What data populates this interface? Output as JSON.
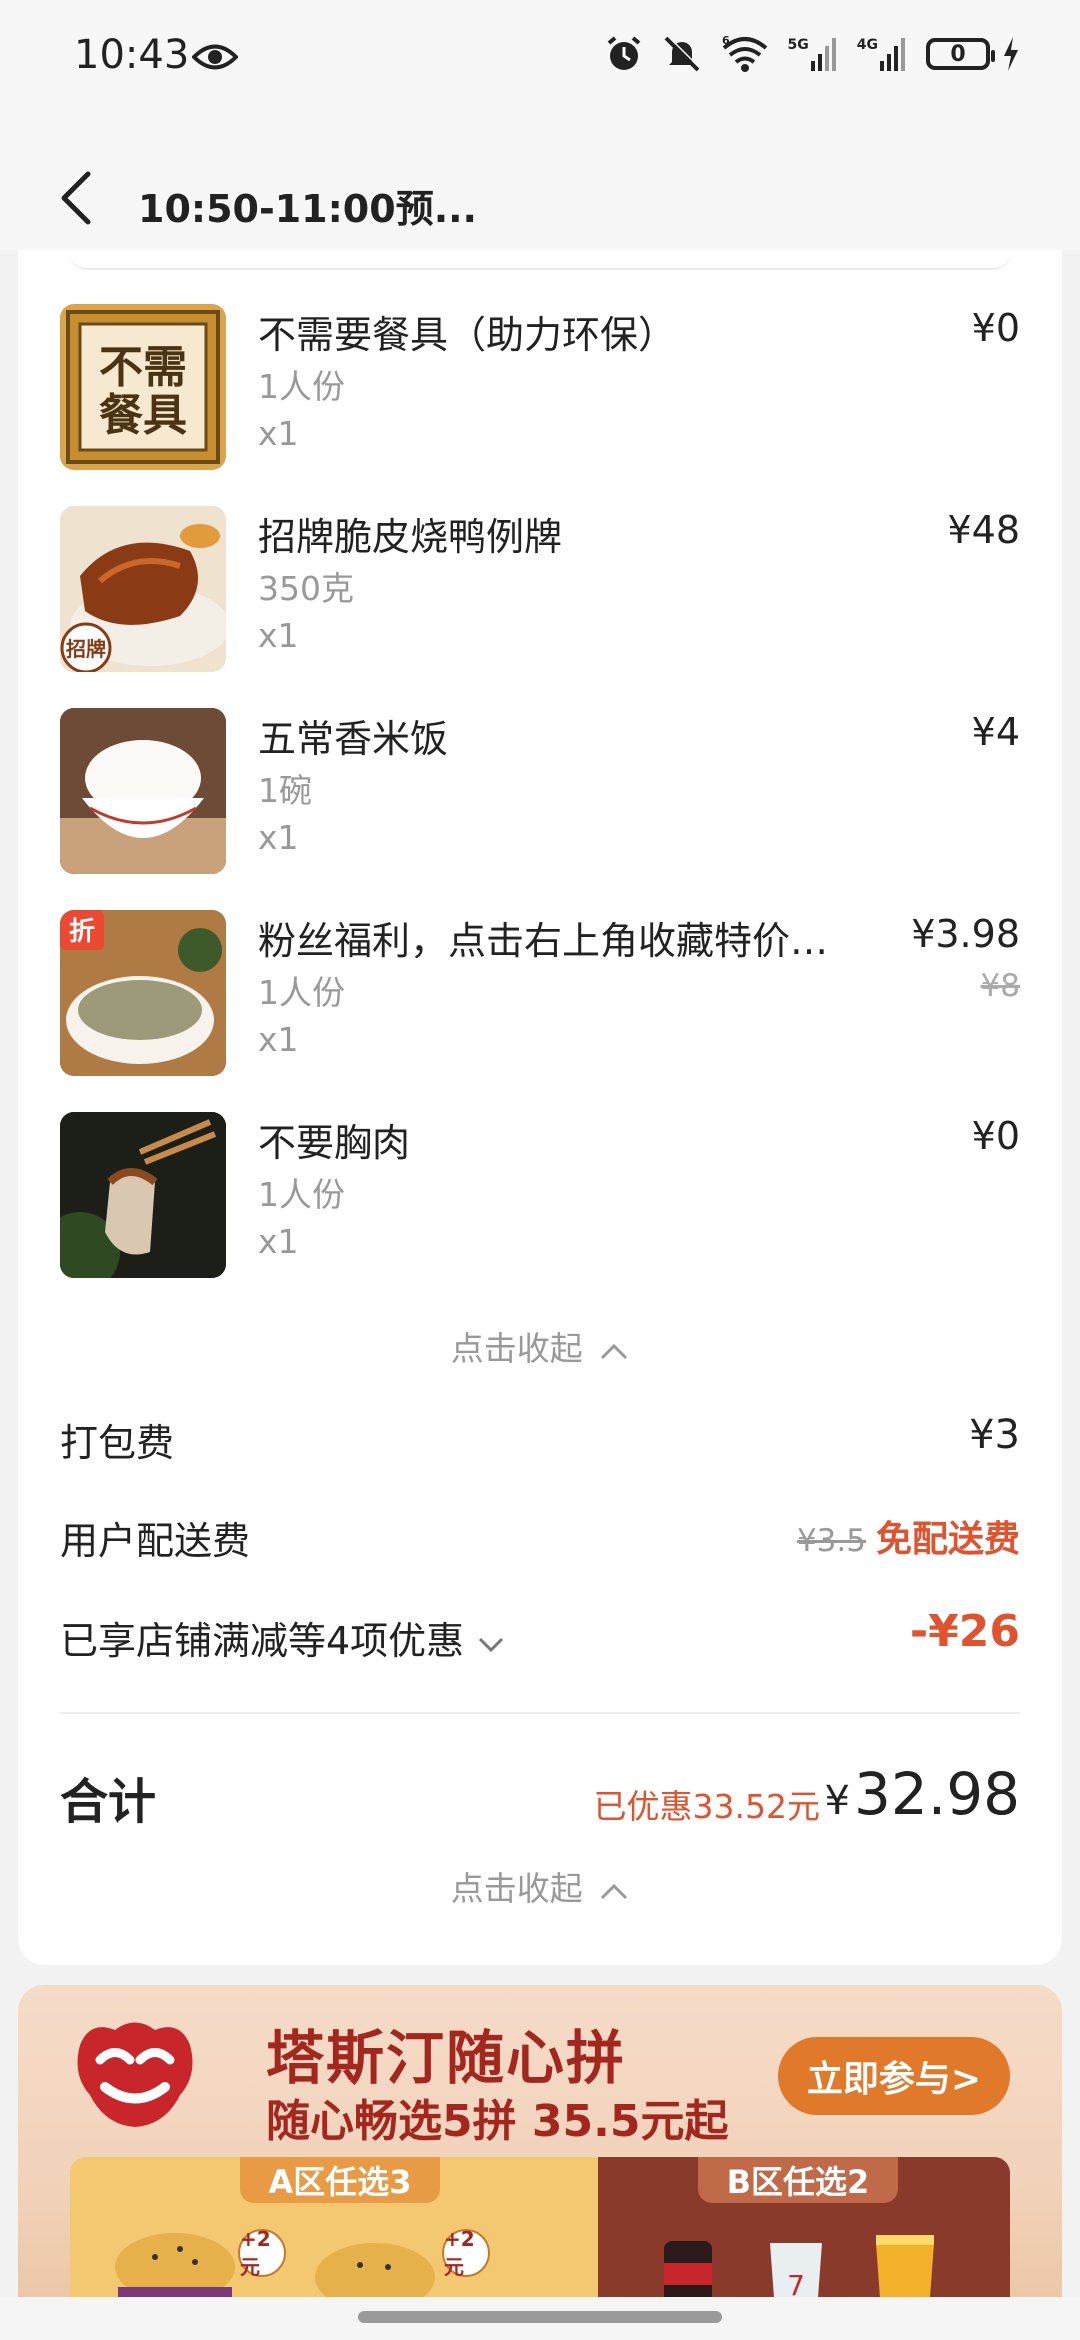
{
  "status_bar": {
    "time": "10:43",
    "battery": "0",
    "net5g": "5G",
    "net4g": "4G",
    "wifi_tag": "6"
  },
  "header": {
    "title": "10:50-11:00预..."
  },
  "items": [
    {
      "name": "不需要餐具（助力环保）",
      "spec": "1人份",
      "qty": "x1",
      "price": "¥0",
      "orig_price": ""
    },
    {
      "name": "招牌脆皮烧鸭例牌",
      "spec": "350克",
      "qty": "x1",
      "price": "¥48",
      "orig_price": ""
    },
    {
      "name": "五常香米饭",
      "spec": "1碗",
      "qty": "x1",
      "price": "¥4",
      "orig_price": ""
    },
    {
      "name": "粉丝福利，点击右上角收藏特价购...",
      "spec": "1人份",
      "qty": "x1",
      "price": "¥3.98",
      "orig_price": "¥8"
    },
    {
      "name": "不要胸肉",
      "spec": "1人份",
      "qty": "x1",
      "price": "¥0",
      "orig_price": ""
    }
  ],
  "thumb_texts": {
    "utensils_line1": "不需",
    "utensils_line2": "餐具",
    "duck_badge": "招牌",
    "discount_badge": "折"
  },
  "collapse_label": "点击收起",
  "fees": {
    "packing_label": "打包费",
    "packing_value": "¥3",
    "delivery_label": "用户配送费",
    "delivery_orig": "¥3.5",
    "delivery_value": "免配送费",
    "discount_label": "已享店铺满减等4项优惠",
    "discount_value": "-¥26"
  },
  "total": {
    "label": "合计",
    "saved": "已优惠33.52元",
    "yen": "¥",
    "amount": "32.98"
  },
  "banner": {
    "title": "塔斯汀随心拼",
    "subtitle": "随心畅选5拼 35.5元起",
    "button": "立即参与>",
    "zone_a": "A区任选3",
    "zone_b": "B区任选2",
    "plus": "+2元"
  },
  "colors": {
    "accent_red": "#e0532e",
    "banner_red": "#a3271e",
    "join_orange": "#e07a2a"
  }
}
